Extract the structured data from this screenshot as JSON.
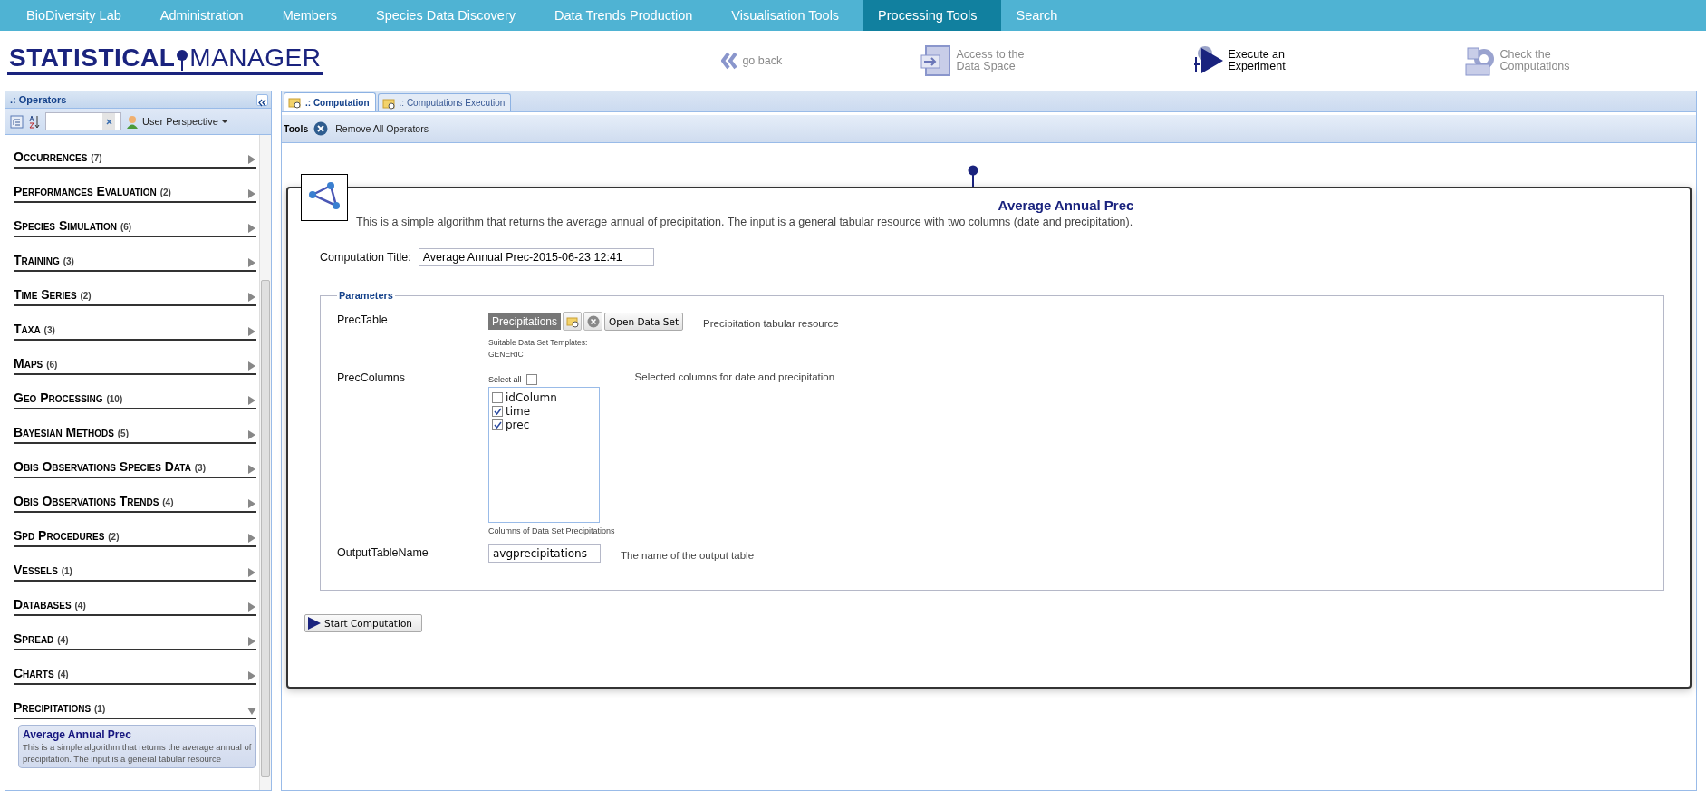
{
  "nav": {
    "items": [
      {
        "label": "BioDiversity Lab",
        "selected": false
      },
      {
        "label": "Administration",
        "selected": false
      },
      {
        "label": "Members",
        "selected": false
      },
      {
        "label": "Species Data Discovery",
        "selected": false
      },
      {
        "label": "Data Trends Production",
        "selected": false
      },
      {
        "label": "Visualisation Tools",
        "selected": false
      },
      {
        "label": "Processing Tools",
        "selected": true
      },
      {
        "label": "Search",
        "selected": false
      }
    ]
  },
  "logo": {
    "left": "STATISTICAL",
    "right": "MANAGER"
  },
  "header_actions": [
    {
      "kind": "back",
      "label": "go back",
      "selected": false
    },
    {
      "kind": "data",
      "label": "Access to the Data Space",
      "selected": false
    },
    {
      "kind": "execute",
      "label": "Execute an Experiment",
      "selected": true
    },
    {
      "kind": "check",
      "label": "Check the Computations",
      "selected": false
    }
  ],
  "sidebar": {
    "title": ".: Operators",
    "perspective": "User Perspective",
    "categories": [
      {
        "name": "Occurrences",
        "count": "(7)",
        "expanded": false
      },
      {
        "name": "Performances Evaluation",
        "count": "(2)",
        "expanded": false
      },
      {
        "name": "Species Simulation",
        "count": "(6)",
        "expanded": false
      },
      {
        "name": "Training",
        "count": "(3)",
        "expanded": false
      },
      {
        "name": "Time Series",
        "count": "(2)",
        "expanded": false
      },
      {
        "name": "Taxa",
        "count": "(3)",
        "expanded": false
      },
      {
        "name": "Maps",
        "count": "(6)",
        "expanded": false
      },
      {
        "name": "Geo Processing",
        "count": "(10)",
        "expanded": false
      },
      {
        "name": "Bayesian Methods",
        "count": "(5)",
        "expanded": false
      },
      {
        "name": "Obis Observations Species Data",
        "count": "(3)",
        "expanded": false
      },
      {
        "name": "Obis Observations Trends",
        "count": "(4)",
        "expanded": false
      },
      {
        "name": "Spd Procedures",
        "count": "(2)",
        "expanded": false
      },
      {
        "name": "Vessels",
        "count": "(1)",
        "expanded": false
      },
      {
        "name": "Databases",
        "count": "(4)",
        "expanded": false
      },
      {
        "name": "Spread",
        "count": "(4)",
        "expanded": false
      },
      {
        "name": "Charts",
        "count": "(4)",
        "expanded": false
      },
      {
        "name": "Precipitations",
        "count": "(1)",
        "expanded": true,
        "children": [
          {
            "title": "Average Annual Prec",
            "description": "This is a simple algorithm that returns the average annual of precipitation. The input is a general tabular resource",
            "selected": true
          }
        ]
      }
    ]
  },
  "main": {
    "tabs": [
      {
        "label": ".: Computation",
        "selected": true
      },
      {
        "label": ".: Computations Execution",
        "selected": false
      }
    ],
    "tools_label": "Tools",
    "remove_button": "Remove All Operators",
    "operator": {
      "title": "Average Annual Prec",
      "description": "This is a simple algorithm that returns the average annual of precipitation. The input is a general tabular resource with two columns (date and precipitation).",
      "computation_title_label": "Computation Title:",
      "computation_title_value": "Average Annual Prec-2015-06-23 12:41",
      "parameters_legend": "Parameters",
      "parameters": [
        {
          "kind": "table",
          "name": "PrecTable",
          "value": "Precipitations",
          "open_button": "Open Data Set",
          "hint": "Suitable Data Set Templates:",
          "hint_value": "GENERIC",
          "description": "Precipitation tabular resource"
        },
        {
          "kind": "columns",
          "name": "PrecColumns",
          "select_all_label": "Select all",
          "select_all_checked": false,
          "options": [
            {
              "label": "idColumn",
              "checked": false
            },
            {
              "label": "time",
              "checked": true
            },
            {
              "label": "prec",
              "checked": true
            }
          ],
          "footnote": "Columns of Data Set Precipitations",
          "description": "Selected columns for date and precipitation"
        },
        {
          "kind": "text",
          "name": "OutputTableName",
          "value": "avgprecipitations",
          "description": "The name of the output table"
        }
      ],
      "start_button": "Start Computation"
    }
  }
}
